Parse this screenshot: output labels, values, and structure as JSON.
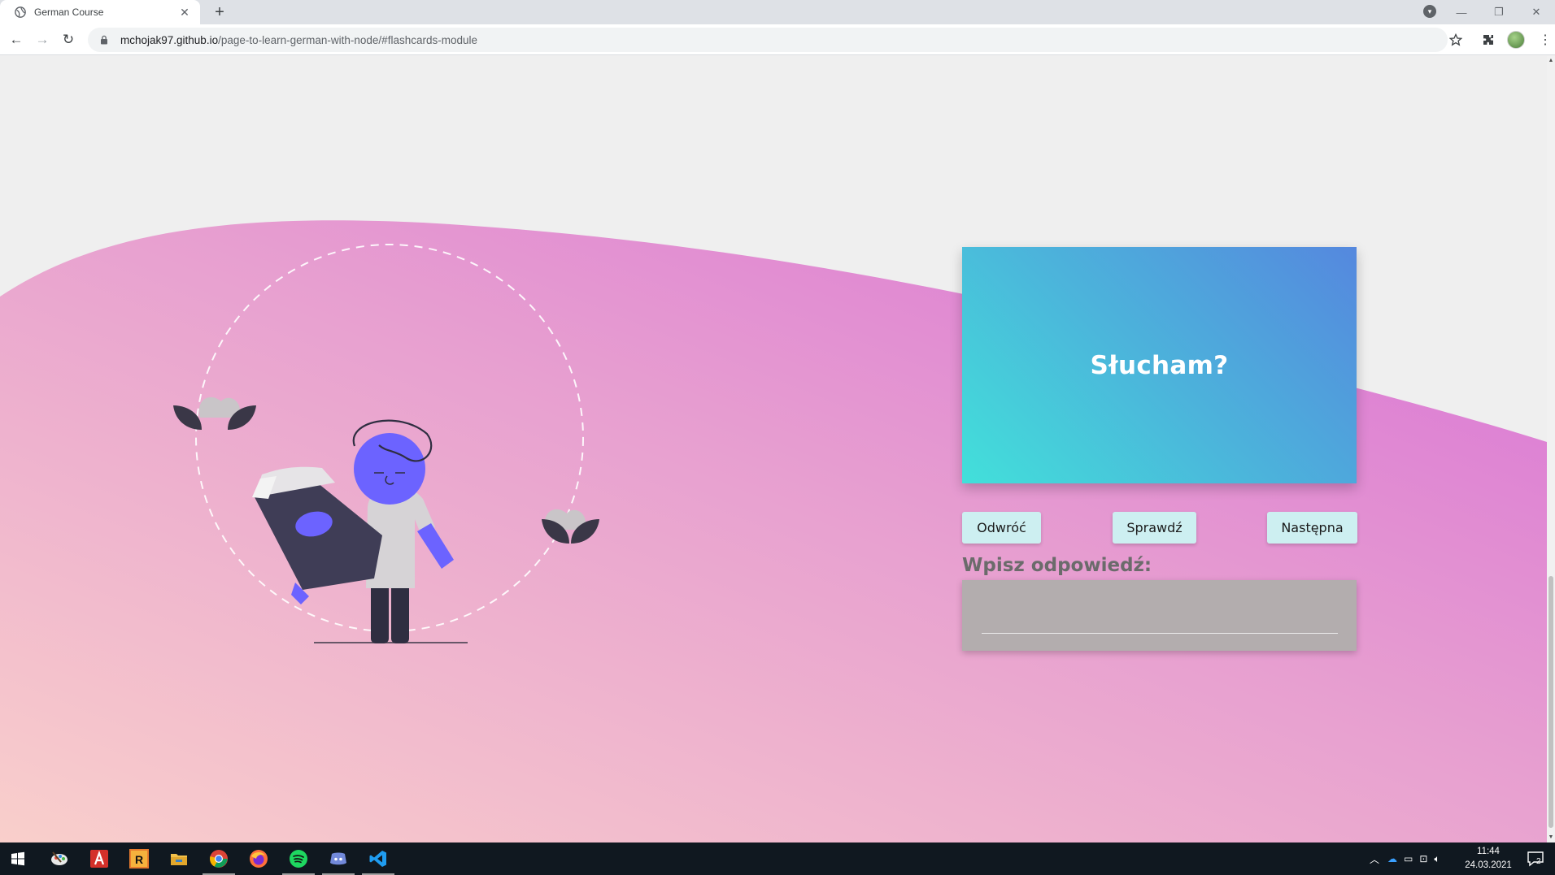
{
  "browser": {
    "tab_title": "German Course",
    "url_host": "mchojak97.github.io",
    "url_path": "/page-to-learn-german-with-node/#flashcards-module",
    "new_tab_label": "+",
    "close_tab_label": "✕"
  },
  "flashcard": {
    "word": "Słucham?"
  },
  "buttons": {
    "flip": "Odwróć",
    "check": "Sprawdź",
    "next": "Następna"
  },
  "answer": {
    "label": "Wpisz odpowiedź:",
    "value": "",
    "placeholder": ""
  },
  "taskbar": {
    "time": "11:44",
    "date": "24.03.2021",
    "notifications": "2",
    "apps": [
      "start-icon",
      "paint-icon",
      "acrobat-icon",
      "rider-icon",
      "file-explorer-icon",
      "chrome-icon",
      "firefox-icon",
      "spotify-icon",
      "discord-icon",
      "vscode-icon"
    ]
  },
  "colors": {
    "card_gradient_start": "#42e0da",
    "card_gradient_end": "#5588de",
    "wave_top": "#dd7fd8",
    "wave_bottom": "#f8c8cc",
    "button_bg": "#cdeff1",
    "answer_box_bg": "#b3adae",
    "character_accent": "#6c63ff"
  }
}
